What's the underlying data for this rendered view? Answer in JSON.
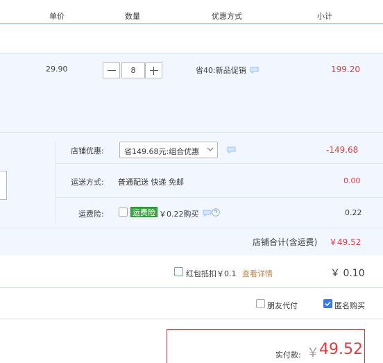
{
  "header": {
    "col_price": "单价",
    "col_qty": "数量",
    "col_promo": "优惠方式",
    "col_subtotal": "小计"
  },
  "item": {
    "price": "29.90",
    "quantity": "8",
    "promo": "省40:新品促销",
    "subtotal": "199.20"
  },
  "store": {
    "discount_label": "店铺优惠:",
    "discount_option": "省149.68元:组合优惠",
    "discount_amount": "-149.68",
    "shipping_label": "运送方式:",
    "shipping_method": "普通配送 快递 免邮",
    "shipping_amount": "0.00",
    "insurance_label": "运费险:",
    "insurance_badge": "运费险",
    "insurance_price": "￥0.22购买",
    "insurance_amount": "0.22",
    "total_label": "店铺合计(含运费)",
    "total_value": "￥49.52"
  },
  "redpacket": {
    "label": "红包抵扣￥0.1",
    "details_link": "查看详情",
    "amount": "￥ 0.10"
  },
  "options": {
    "friend_pay": "朋友代付",
    "anonymous": "匿名购买"
  },
  "payment": {
    "label": "实付款:",
    "currency": "￥",
    "amount": "49.52"
  },
  "colors": {
    "accent_red": "#e4393c",
    "panel_bg": "#f2f7ff",
    "header_line": "#b2d1ff",
    "badge_green": "#3aa341",
    "checkbox_blue": "#3b78e7"
  }
}
